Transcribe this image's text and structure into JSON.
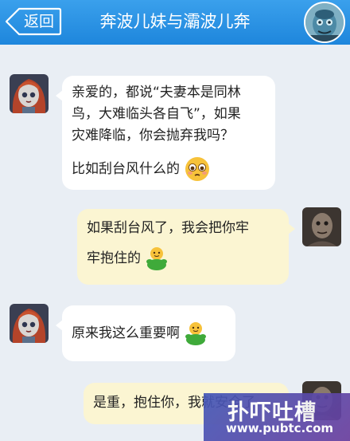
{
  "header": {
    "back_label": "返回",
    "title": "奔波儿妹与灞波儿奔",
    "avatar_icon": "monster-avatar-icon"
  },
  "messages": [
    {
      "side": "left",
      "sender_avatar": "girl-doll-avatar",
      "lines": [
        "亲爱的，都说“夫妻本是同林",
        "鸟，大难临头各自飞”，如果",
        "灾难降临，你会抛弃我吗？",
        "比如刮台风什么的"
      ],
      "emoji": "pleading-face-emoji"
    },
    {
      "side": "right",
      "sender_avatar": "monster-avatar",
      "lines": [
        "如果刮台风了，我会把你牢",
        "牢抱住的"
      ],
      "emoji": "green-hug-emoji"
    },
    {
      "side": "left",
      "sender_avatar": "girl-doll-avatar",
      "lines": [
        "原来我这么重要啊"
      ],
      "emoji": "green-hug-emoji"
    },
    {
      "side": "right",
      "sender_avatar": "monster-avatar",
      "lines": [
        "是重，抱住你，我就安全了"
      ]
    }
  ],
  "watermark": {
    "title": "扑吓吐槽",
    "url": "www.pubtc.com"
  },
  "colors": {
    "header_blue": "#1e86dc",
    "background": "#e9eef4",
    "incoming_bubble": "#ffffff",
    "outgoing_bubble": "#fbf5d2"
  }
}
